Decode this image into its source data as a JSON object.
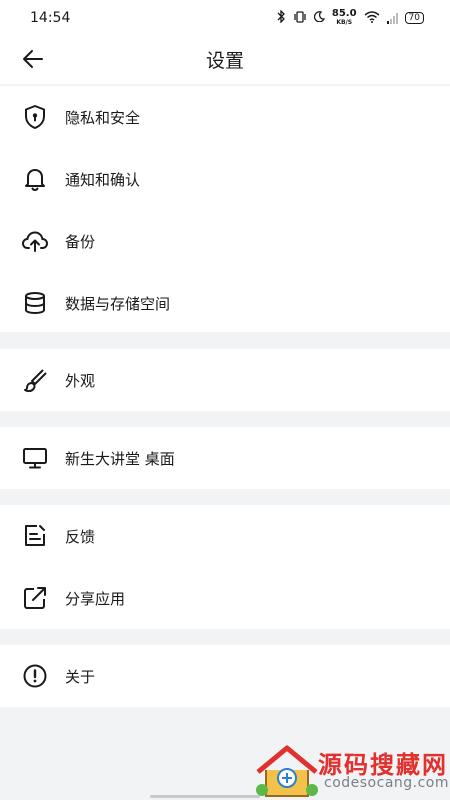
{
  "status_bar": {
    "time": "14:54",
    "net_speed_value": "85.0",
    "net_speed_unit": "KB/S",
    "battery": "70",
    "icons": [
      "bluetooth-icon",
      "vibrate-icon",
      "moon-icon",
      "wifi-icon",
      "signal-icon"
    ]
  },
  "header": {
    "title": "设置",
    "back_icon": "arrow-left-icon"
  },
  "sections": [
    {
      "items": [
        {
          "label": "隐私和安全",
          "icon": "shield-lock-icon"
        },
        {
          "label": "通知和确认",
          "icon": "bell-icon"
        },
        {
          "label": "备份",
          "icon": "cloud-upload-icon"
        },
        {
          "label": "数据与存储空间",
          "icon": "database-icon"
        }
      ]
    },
    {
      "items": [
        {
          "label": "外观",
          "icon": "brush-icon"
        }
      ]
    },
    {
      "items": [
        {
          "label": "新生大讲堂 桌面",
          "icon": "monitor-icon"
        }
      ]
    },
    {
      "items": [
        {
          "label": "反馈",
          "icon": "feedback-icon"
        },
        {
          "label": "分享应用",
          "icon": "share-icon"
        }
      ]
    },
    {
      "items": [
        {
          "label": "关于",
          "icon": "info-icon"
        }
      ]
    }
  ],
  "watermark": {
    "title": "源码搜藏网",
    "url": "codesocang.com"
  },
  "colors": {
    "background": "#f2f3f5",
    "surface": "#ffffff",
    "text": "#1a1a1a",
    "watermark_red": "#e0312f"
  }
}
